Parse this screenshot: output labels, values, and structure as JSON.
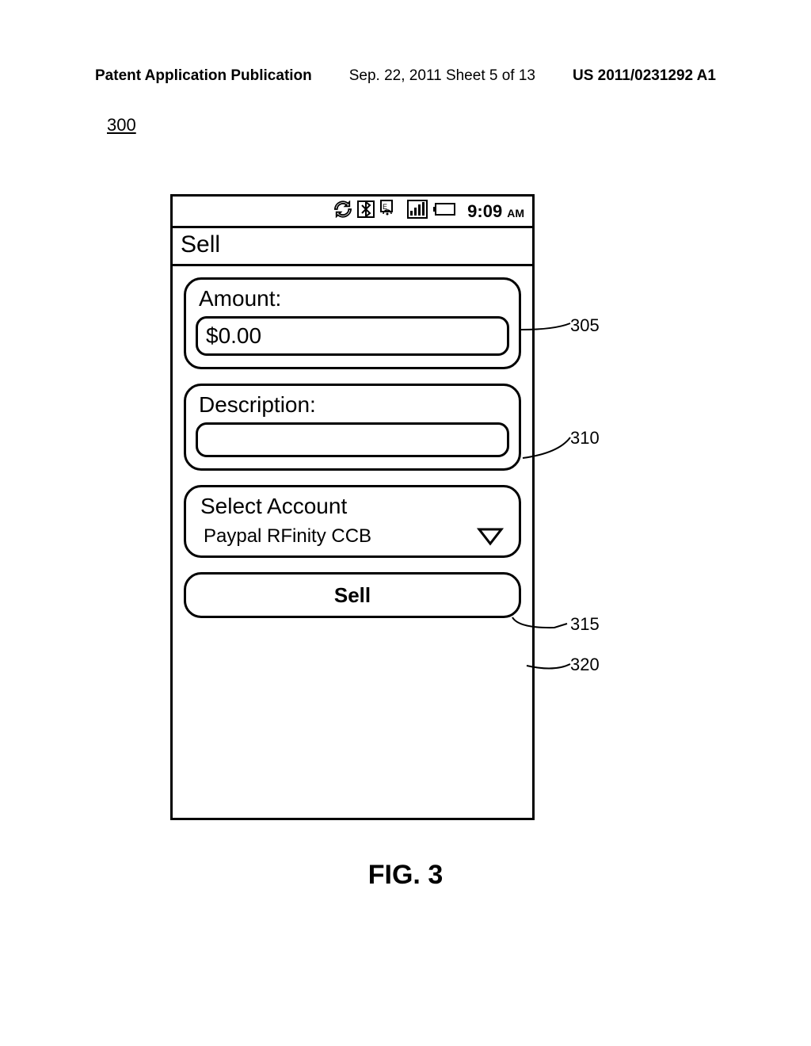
{
  "header": {
    "left": "Patent Application Publication",
    "center": "Sep. 22, 2011   Sheet 5 of 13",
    "right": "US 2011/0231292 A1"
  },
  "figure_ref": "300",
  "status": {
    "time": "9:09",
    "ampm": "AM"
  },
  "title": "Sell",
  "amount": {
    "label": "Amount:",
    "value": "$0.00"
  },
  "description": {
    "label": "Description:",
    "value": ""
  },
  "account": {
    "label": "Select Account",
    "value": "Paypal RFinity CCB"
  },
  "button": {
    "label": "Sell"
  },
  "callouts": {
    "c305": "305",
    "c310": "310",
    "c315": "315",
    "c320": "320"
  },
  "caption": "FIG. 3"
}
